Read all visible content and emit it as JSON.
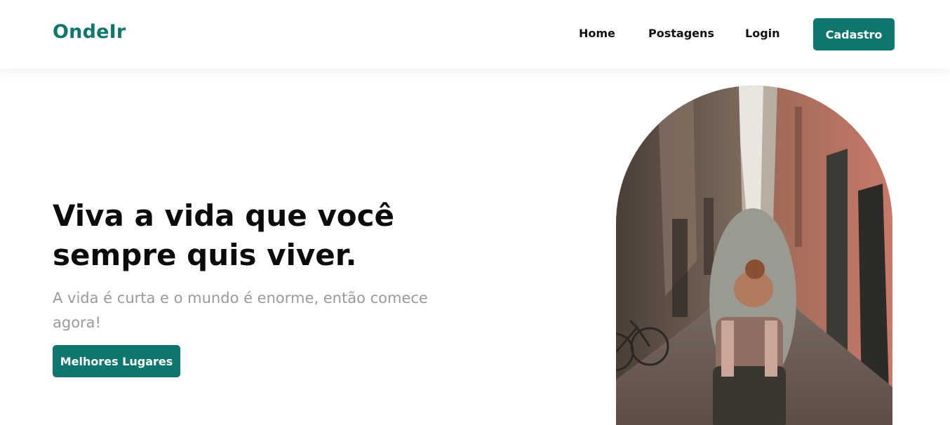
{
  "nav": {
    "brand": "OndeIr",
    "links": [
      {
        "label": "Home"
      },
      {
        "label": "Postagens"
      },
      {
        "label": "Login"
      }
    ],
    "cta_label": "Cadastro"
  },
  "hero": {
    "title": "Viva a vida que você sempre quis viver.",
    "subtitle": "A vida é curta e o mundo é enorme, então comece agora!",
    "button_label": "Melhores Lugares"
  },
  "colors": {
    "brand": "#0f766e",
    "text": "#111111",
    "muted": "#9a9a9a"
  }
}
